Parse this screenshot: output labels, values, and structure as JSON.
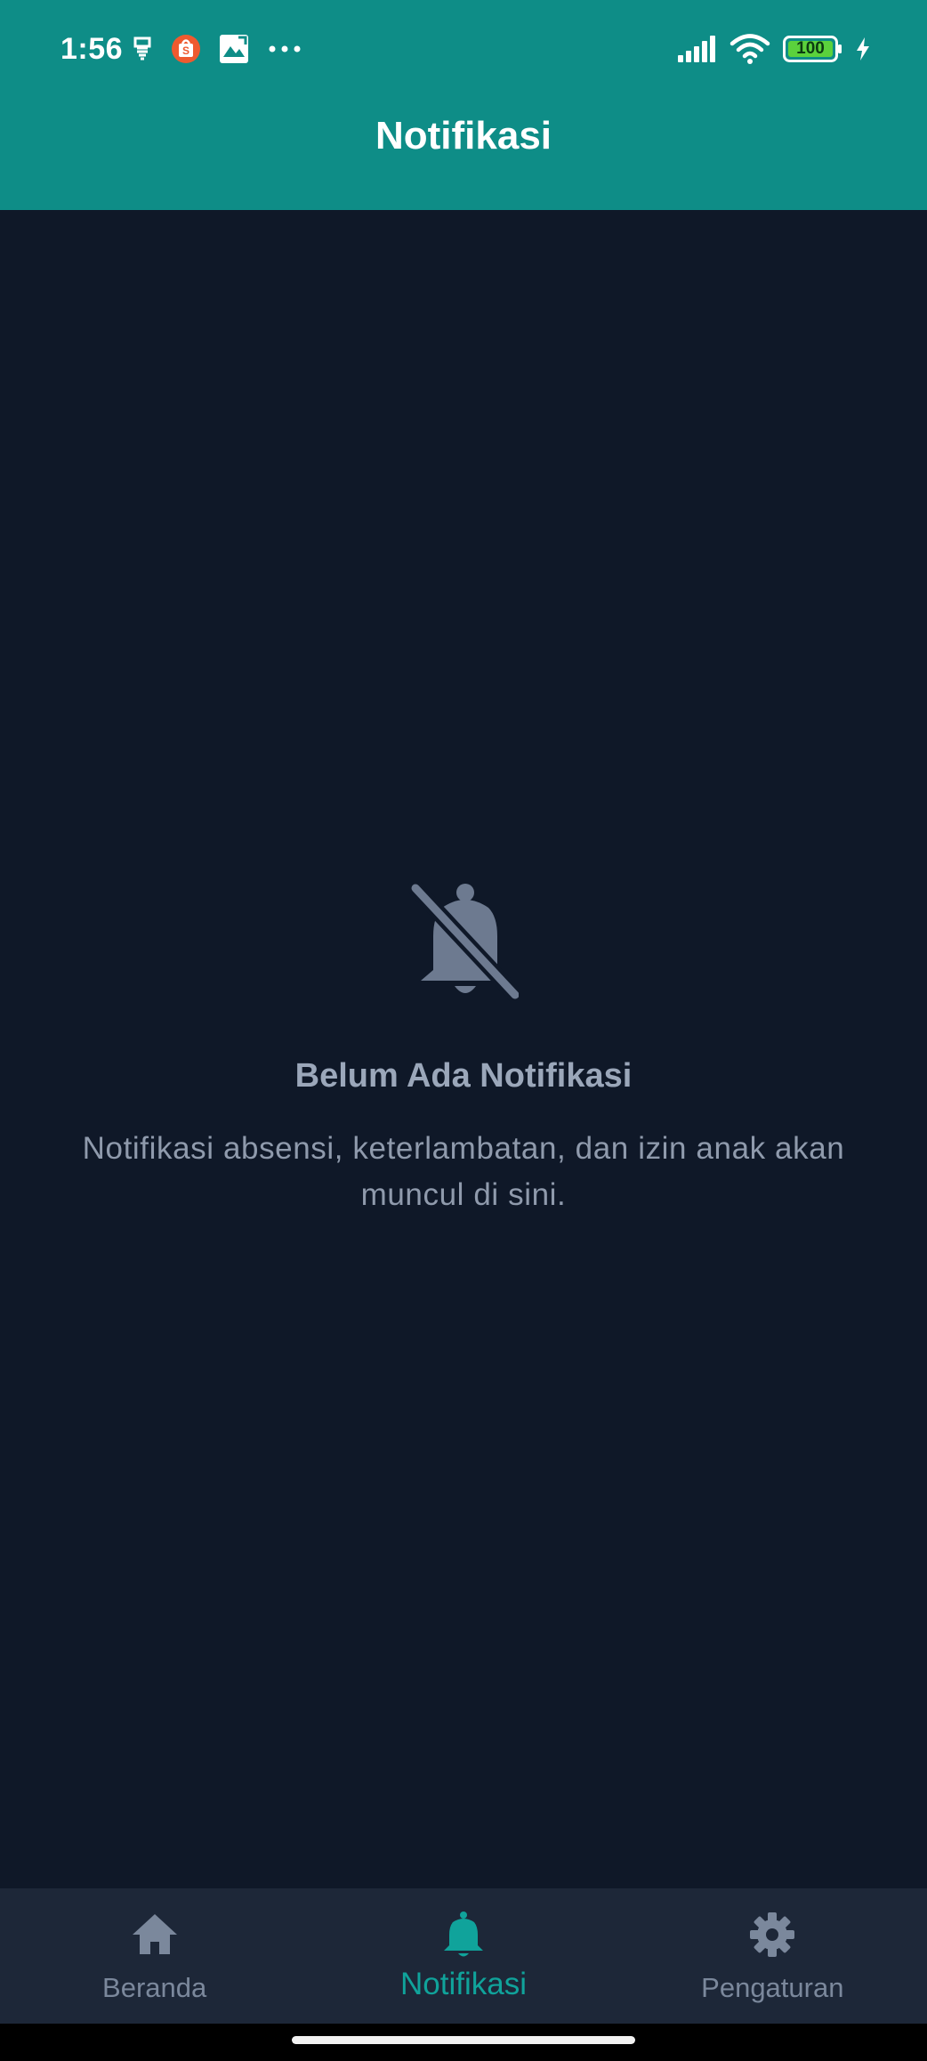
{
  "status_bar": {
    "time": "1:56",
    "battery_level": "100",
    "left_icons": [
      "sim-icon",
      "shopee-icon",
      "gallery-icon",
      "more-dots-icon"
    ],
    "right_icons": [
      "signal-icon",
      "wifi-icon",
      "battery-icon",
      "charging-icon"
    ]
  },
  "app_bar": {
    "title": "Notifikasi",
    "background_color": "#0e8d87"
  },
  "empty_state": {
    "icon": "bell-off-icon",
    "title": "Belum Ada Notifikasi",
    "description": "Notifikasi absensi, keterlambatan, dan izin anak akan muncul di sini."
  },
  "bottom_nav": {
    "items": [
      {
        "label": "Beranda",
        "icon": "home-icon",
        "active": false
      },
      {
        "label": "Notifikasi",
        "icon": "bell-icon",
        "active": true
      },
      {
        "label": "Pengaturan",
        "icon": "gear-icon",
        "active": false
      }
    ],
    "active_color": "#10a39b",
    "inactive_color": "#7b889c"
  },
  "colors": {
    "background": "#0f1828",
    "nav_background": "#1d2738"
  }
}
